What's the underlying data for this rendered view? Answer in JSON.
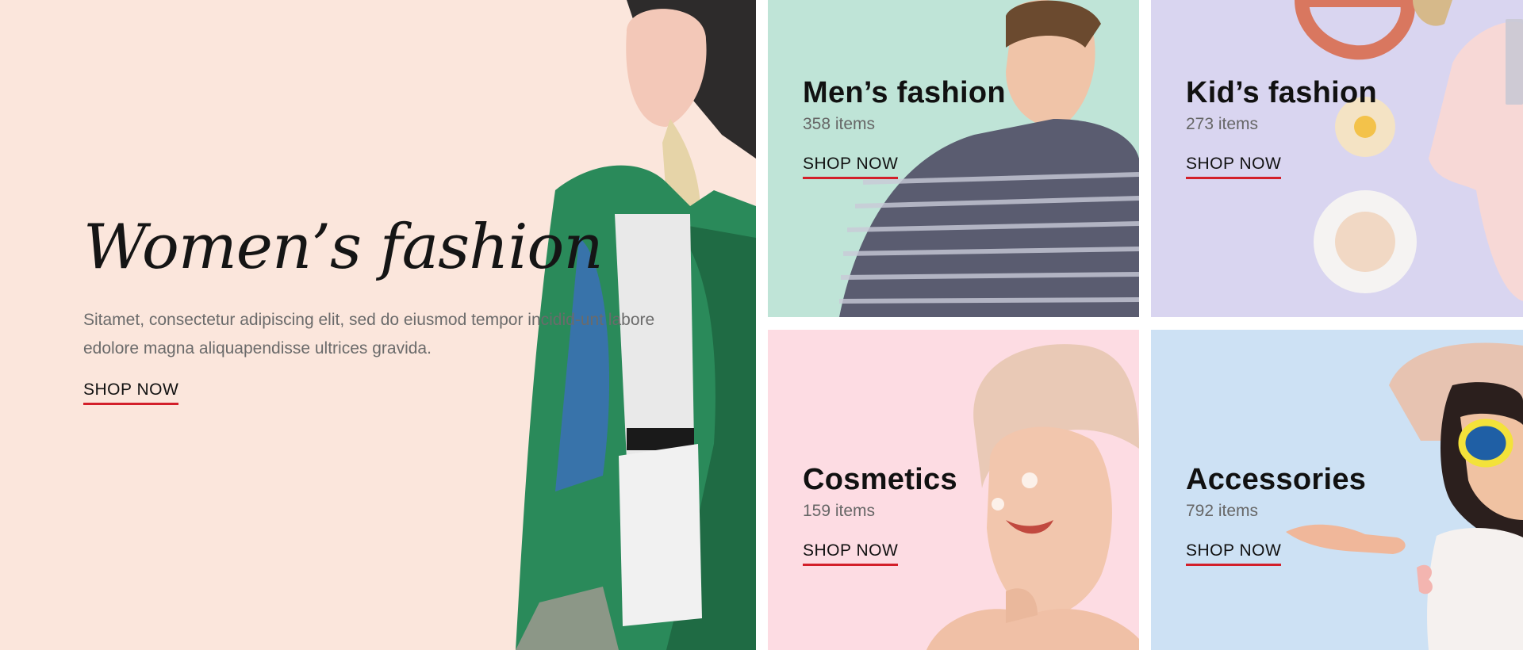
{
  "hero": {
    "title": "Women’s fashion",
    "description": "Sitamet, consectetur adipiscing elit, sed do eiusmod tempor incidid-unt labore edolore magna aliquapendisse ultrices gravida.",
    "cta": "SHOP NOW",
    "background": "#fbe6dc"
  },
  "categories": [
    {
      "title": "Men’s fashion",
      "count": "358 items",
      "cta": "SHOP NOW",
      "background": "#bfe4d7"
    },
    {
      "title": "Kid’s fashion",
      "count": "273 items",
      "cta": "SHOP NOW",
      "background": "#d9d5f0"
    },
    {
      "title": "Cosmetics",
      "count": "159 items",
      "cta": "SHOP NOW",
      "background": "#fddce3"
    },
    {
      "title": "Accessories",
      "count": "792 items",
      "cta": "SHOP NOW",
      "background": "#cde1f4"
    }
  ],
  "accent_color": "#d31f2a"
}
